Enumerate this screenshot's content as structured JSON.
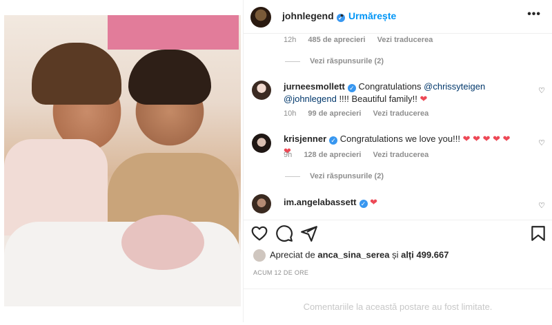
{
  "post": {
    "author": "johnlegend",
    "follow_label": "Urmărește",
    "separator": "•",
    "more_label": "•••"
  },
  "comments": {
    "top_meta": {
      "time": "12h",
      "likes": "485 de aprecieri",
      "translate": "Vezi traducerea"
    },
    "top_replies": "Vezi răspunsurile (2)",
    "items": [
      {
        "username": "jurneesmollett",
        "text_prefix": "Congratulations ",
        "mention1": "@chrissyteigen",
        "mention2": "@johnlegend",
        "text_suffix": " !!!! Beautiful family!! ",
        "emoji": "❤",
        "time": "10h",
        "likes": "99 de aprecieri",
        "translate": "Vezi traducerea"
      },
      {
        "username": "krisjenner",
        "text": "Congratulations we love you!!! ",
        "emoji": "❤ ❤ ❤ ❤ ❤ ❤",
        "time": "9h",
        "likes": "128 de aprecieri",
        "translate": "Vezi traducerea",
        "replies": "Vezi răspunsurile (2)"
      },
      {
        "username": "im.angelabassett",
        "emoji": "❤"
      }
    ]
  },
  "likes": {
    "prefix": "Apreciat de ",
    "user": "anca_sina_serea",
    "middle": " și ",
    "others": "alți 499.667"
  },
  "timestamp": "ACUM 12 DE ORE",
  "limited_notice": "Comentariile la această postare au fost limitate.",
  "icons": {
    "like": "heart-icon",
    "comment": "comment-icon",
    "share": "share-icon",
    "save": "bookmark-icon",
    "verified": "verified-badge-icon"
  },
  "colors": {
    "accent": "#0095f6",
    "verified": "#3897f0",
    "heart": "#ed4956",
    "muted": "#8e8e8e"
  }
}
